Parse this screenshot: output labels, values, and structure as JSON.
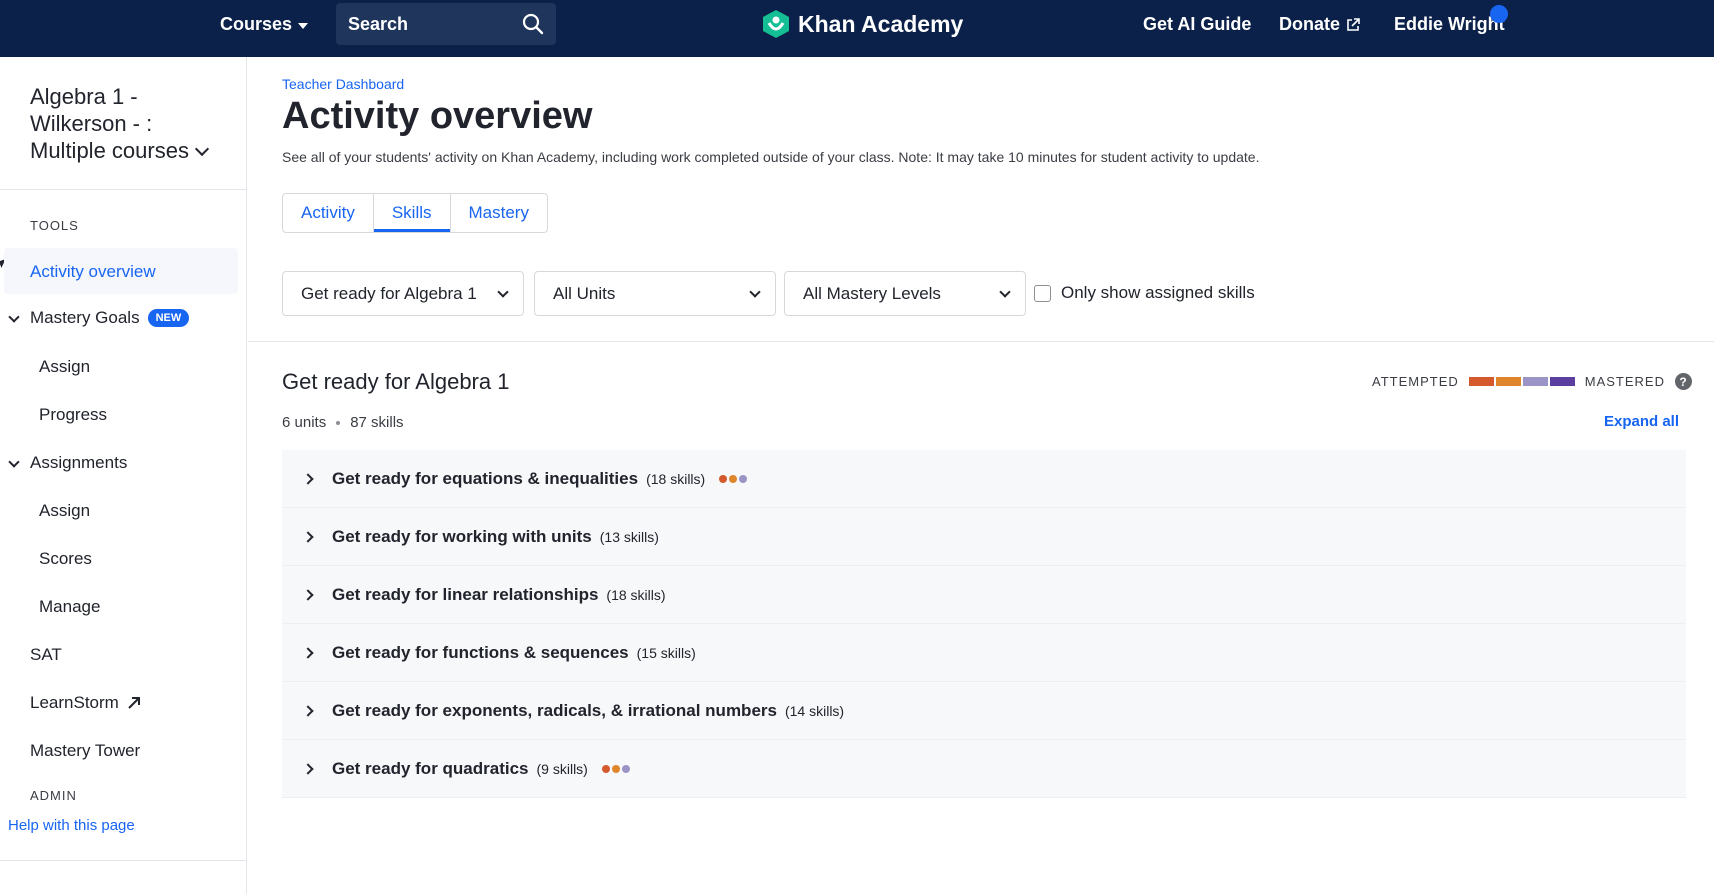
{
  "nav": {
    "courses": "Courses",
    "search_placeholder": "Search",
    "logo": "Khan Academy",
    "ai_guide": "Get AI Guide",
    "donate": "Donate",
    "user": "Eddie Wright"
  },
  "sidebar": {
    "class_title": "Algebra 1 - Wilkerson - : Multiple courses",
    "tools_heading": "TOOLS",
    "activity_overview": "Activity overview",
    "mastery_goals": "Mastery Goals",
    "new_badge": "NEW",
    "mg_assign": "Assign",
    "mg_progress": "Progress",
    "assignments": "Assignments",
    "as_assign": "Assign",
    "as_scores": "Scores",
    "as_manage": "Manage",
    "sat": "SAT",
    "learnstorm": "LearnStorm",
    "mastery_tower": "Mastery Tower",
    "admin_heading": "ADMIN",
    "help": "Help with this page"
  },
  "main": {
    "breadcrumb": "Teacher Dashboard",
    "title": "Activity overview",
    "description": "See all of your students' activity on Khan Academy, including work completed outside of your class. Note: It may take 10 minutes for student activity to update.",
    "tabs": [
      "Activity",
      "Skills",
      "Mastery"
    ],
    "active_tab": "Skills",
    "filters": {
      "course": "Get ready for Algebra 1",
      "units": "All Units",
      "mastery": "All Mastery Levels",
      "assigned_only": "Only show assigned skills"
    },
    "course": {
      "title": "Get ready for Algebra 1",
      "units": "6 units",
      "skills": "87 skills",
      "legend_attempted": "ATTEMPTED",
      "legend_mastered": "MASTERED",
      "legend_colors": [
        "#d45a2e",
        "#e0862a",
        "#9a94c7",
        "#5b3f9e"
      ],
      "expand_all": "Expand all"
    },
    "units": [
      {
        "name": "Get ready for equations & inequalities",
        "count": "(18 skills)",
        "dots": [
          "#d45a2e",
          "#e0862a",
          "#9a94c7"
        ]
      },
      {
        "name": "Get ready for working with units",
        "count": "(13 skills)",
        "dots": []
      },
      {
        "name": "Get ready for linear relationships",
        "count": "(18 skills)",
        "dots": []
      },
      {
        "name": "Get ready for functions & sequences",
        "count": "(15 skills)",
        "dots": []
      },
      {
        "name": "Get ready for exponents, radicals, & irrational numbers",
        "count": "(14 skills)",
        "dots": []
      },
      {
        "name": "Get ready for quadratics",
        "count": "(9 skills)",
        "dots": [
          "#d45a2e",
          "#e0862a",
          "#9a94c7"
        ]
      }
    ]
  }
}
